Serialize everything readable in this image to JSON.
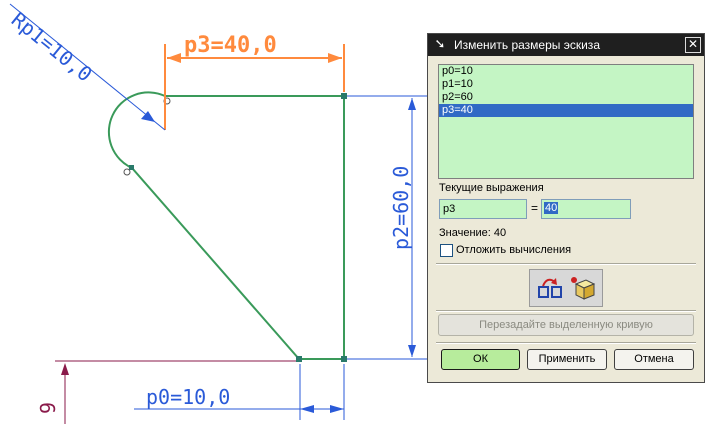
{
  "drawing": {
    "dim_p3": "p3=40,0",
    "dim_rp1": "Rp1=10,0",
    "dim_p2": "p2=60,0",
    "dim_p0": "p0=10,0",
    "dim_left": "9",
    "colors": {
      "profile": "#3a9a5a",
      "dim_active": "#ff8a3d",
      "dim_normal": "#2a5ad8",
      "datum": "#8a1a4a"
    }
  },
  "dialog": {
    "title": "Изменить размеры эскиза",
    "title_icon": "arrow-cursor-icon",
    "close_label": "✕",
    "expressions": [
      "p0=10",
      "p1=10",
      "p2=60",
      "p3=40"
    ],
    "selected_index": 3,
    "current_label": "Текущие выражения",
    "name_value": "p3",
    "equals": "=",
    "value_value": "40",
    "value_readout": "Значение: 40",
    "defer_label": "Отложить вычисления",
    "defer_checked": false,
    "reselect_label": "Перезадайте выделенную кривую",
    "ok_label": "ОК",
    "apply_label": "Применить",
    "cancel_label": "Отмена"
  }
}
